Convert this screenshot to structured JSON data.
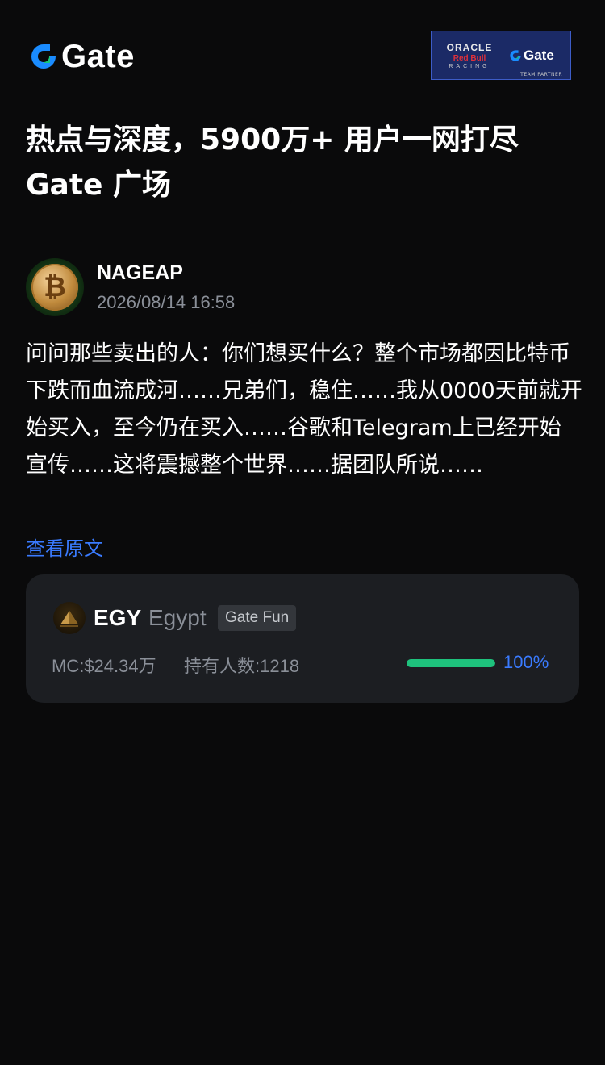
{
  "header": {
    "logo_text": "Gate",
    "logo_icon": "gate-logo-icon",
    "partner": {
      "oracle": "ORACLE",
      "redbull": "Red Bull",
      "racing": "RACING",
      "gate": "Gate",
      "team": "TEAM PARTNER"
    }
  },
  "headline": "热点与深度，5900万+ 用户一网打尽 Gate 广场",
  "post": {
    "author": "NAGEAP",
    "timestamp": "2026/08/14 16:58",
    "avatar_icon": "bitcoin-coin-icon",
    "body": "问问那些卖出的人：你们想买什么？整个市场都因比特币下跌而血流成河……兄弟们，稳住……我从0000天前就开始买入，至今仍在买入……谷歌和Telegram上已经开始宣传……这将震撼整个世界……据团队所说……",
    "read_more": "查看原文"
  },
  "token": {
    "symbol": "EGY",
    "name": "Egypt",
    "tag": "Gate Fun",
    "logo_icon": "pyramid-icon",
    "market_cap": "MC:$24.34万",
    "holders": "持有人数:1218",
    "progress": 1.0,
    "progress_label": "100%"
  },
  "colors": {
    "background": "#0a0a0b",
    "card": "#1c1e22",
    "accent_blue": "#3a7bff",
    "progress_green": "#1ec27d",
    "muted_text": "#8a8f98"
  }
}
